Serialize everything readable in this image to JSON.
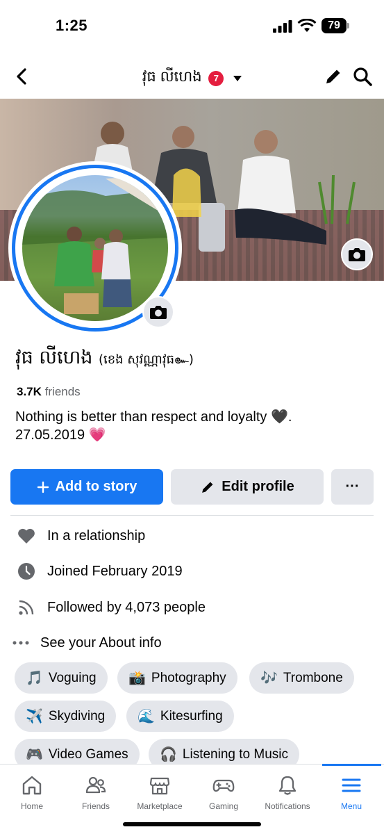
{
  "status": {
    "time": "1:25",
    "battery": "79"
  },
  "header": {
    "title": "វុធ លីហេង",
    "badge": "7"
  },
  "profile": {
    "name": "វុធ លីហេង",
    "alt_name": "(ខេង សុវណ្ណាវុធ๛)",
    "friends_count": "3.7K",
    "friends_label": "friends",
    "bio_line1": "Nothing is better than respect and loyalty 🖤.",
    "bio_line2": "27.05.2019 💗"
  },
  "actions": {
    "add_story": "Add to story",
    "edit_profile": "Edit profile",
    "more": "···"
  },
  "details": {
    "relationship": "In a relationship",
    "joined": "Joined February 2019",
    "followed": "Followed by 4,073 people",
    "about": "See your About info"
  },
  "hobbies": [
    {
      "emoji": "🎵",
      "label": "Voguing"
    },
    {
      "emoji": "📸",
      "label": "Photography"
    },
    {
      "emoji": "🎶",
      "label": "Trombone"
    },
    {
      "emoji": "✈️",
      "label": "Skydiving"
    },
    {
      "emoji": "🌊",
      "label": "Kitesurfing"
    },
    {
      "emoji": "🎮",
      "label": "Video Games"
    },
    {
      "emoji": "🎧",
      "label": "Listening to Music"
    }
  ],
  "tabs": [
    {
      "label": "Home",
      "icon": "home-icon"
    },
    {
      "label": "Friends",
      "icon": "friends-icon"
    },
    {
      "label": "Marketplace",
      "icon": "marketplace-icon"
    },
    {
      "label": "Gaming",
      "icon": "gaming-icon"
    },
    {
      "label": "Notifications",
      "icon": "bell-icon"
    },
    {
      "label": "Menu",
      "icon": "menu-icon"
    }
  ],
  "colors": {
    "accent": "#1877f2",
    "badge": "#e41e3f",
    "chip_bg": "#e4e6eb"
  }
}
